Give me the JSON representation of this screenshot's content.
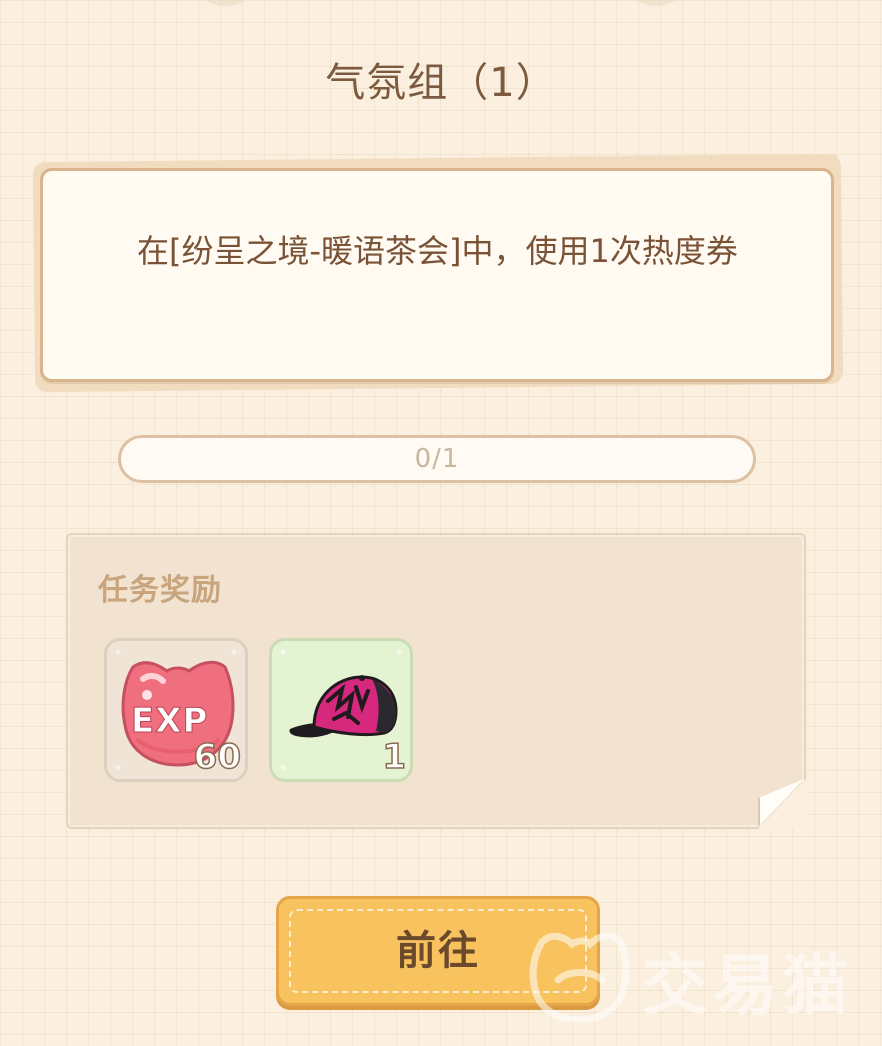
{
  "quest": {
    "title": "气氛组（1）",
    "description": "在[纷呈之境-暖语茶会]中，使用1次热度券"
  },
  "progress": {
    "text": "0/1",
    "current": 0,
    "total": 1,
    "fraction": 0
  },
  "rewards": {
    "title": "任务奖励",
    "items": [
      {
        "icon": "exp-icon",
        "icon_text": "EXP",
        "count": "60"
      },
      {
        "icon": "cap-icon",
        "count": "1"
      }
    ]
  },
  "actions": {
    "goto_label": "前往"
  },
  "watermark": {
    "text": "交易猫"
  },
  "colors": {
    "background": "#fbefdf",
    "title": "#7b5a3f",
    "button": "#f8c35f",
    "exp_badge": "#ef6f7e",
    "cap_pink": "#d6287c"
  }
}
